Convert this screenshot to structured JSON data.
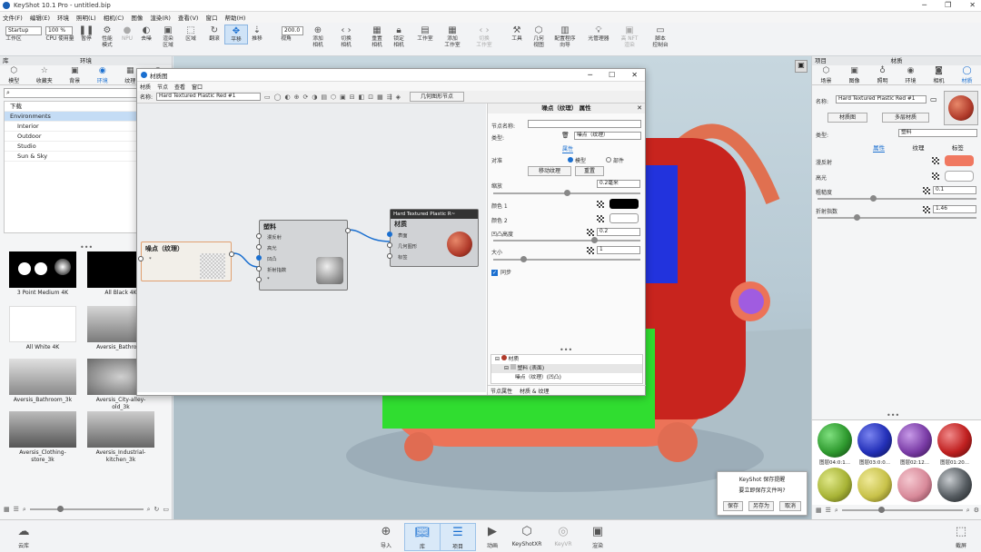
{
  "window": {
    "title": "KeyShot 10.1 Pro  -  untitled.bip"
  },
  "menu": [
    "文件(F)",
    "编辑(E)",
    "环境",
    "照明(L)",
    "相机(C)",
    "图像",
    "渲染(R)",
    "查看(V)",
    "窗口",
    "帮助(H)"
  ],
  "toolbar": {
    "preset": "Startup",
    "zoom": "100 %",
    "speed": "200.0",
    "items": [
      {
        "label": "工作区",
        "icon": "workspace"
      },
      {
        "label": "CPU 使用量",
        "icon": "cpu"
      },
      {
        "label": "暂停",
        "icon": "pause"
      },
      {
        "label": "性能\n模式",
        "icon": "performance"
      },
      {
        "label": "NPU",
        "icon": "npu"
      },
      {
        "label": "去噪",
        "icon": "denoise"
      },
      {
        "label": "渲染\n区域",
        "icon": "region"
      },
      {
        "label": "区域",
        "icon": "region2"
      },
      {
        "label": "翻滚",
        "icon": "tumble"
      },
      {
        "label": "平移",
        "icon": "pan"
      },
      {
        "label": "推移",
        "icon": "dolly"
      },
      {
        "label": "视角",
        "icon": "perspective"
      },
      {
        "label": "添加\n相机",
        "icon": "add-camera"
      },
      {
        "label": "切换\n相机",
        "icon": "switch-camera"
      },
      {
        "label": "重置\n相机",
        "icon": "reset-camera"
      },
      {
        "label": "锁定\n相机",
        "icon": "lock-camera"
      },
      {
        "label": "工作室",
        "icon": "studio"
      },
      {
        "label": "添加\n工作室",
        "icon": "add-studio"
      },
      {
        "label": "切换\n工作室",
        "icon": "switch-studio"
      },
      {
        "label": "工具",
        "icon": "tools"
      },
      {
        "label": "几何\n视图",
        "icon": "geometry"
      },
      {
        "label": "配置程序\n向导",
        "icon": "configurator"
      },
      {
        "label": "光管理器",
        "icon": "light-manager"
      },
      {
        "label": "高 NFT\n渲染",
        "icon": "nft"
      },
      {
        "label": "脚本\n控制台",
        "icon": "script"
      }
    ]
  },
  "library": {
    "title": "库",
    "env_title": "环境",
    "tabs": [
      "模型",
      "收藏夹",
      "背景",
      "环境",
      "纹理",
      "颜色"
    ],
    "tree": [
      "下载",
      "Environments",
      "Interior",
      "Outdoor",
      "Studio",
      "Sun & Sky"
    ],
    "thumbs": [
      "3 Point Medium 4K",
      "All Black 4K",
      "All White 4K",
      "Aversis_Bathroom",
      "Aversis_Bathroom_3k",
      "Aversis_City-alley-old_3k",
      "Aversis_Clothing-store_3k",
      "Aversis_Industrial-kitchen_3k"
    ]
  },
  "bottom": [
    "云库",
    "导入",
    "库",
    "项目",
    "动画",
    "KeyShotXR",
    "KeyVR",
    "渲染"
  ],
  "bottom_right": "截屏",
  "dialog": {
    "title": "材质图",
    "menu": [
      "材质",
      "节点",
      "查看",
      "窗口"
    ],
    "name_label": "名称:",
    "name_value": "Hard Textured Plastic Red #1",
    "geom_label": "几何图形节点",
    "nodes": {
      "bump": {
        "title": "噪点（纹理）",
        "ports": [
          "*"
        ]
      },
      "plastic": {
        "title": "塑料",
        "ports": [
          "漫反射",
          "高光",
          "凹凸",
          "折射指数",
          "*"
        ]
      },
      "material": {
        "header": "Hard Textured Plastic R~",
        "title": "材质",
        "ports": [
          "表面",
          "几何图形",
          "标签"
        ]
      }
    },
    "props": {
      "title": "噪点（纹理） 属性",
      "node_name_label": "节点名称:",
      "type_label": "类型:",
      "type_value": "噪点（纹理）",
      "tab": "属性",
      "align_label": "对准",
      "model": "模型",
      "part": "部件",
      "move_tex": "移动纹理",
      "reset": "重置",
      "scale_label": "缩放",
      "scale_value": "0.2毫米",
      "color1": "颜色 1",
      "color2": "颜色 2",
      "bump_label": "凹凸高度",
      "bump_value": "0.2",
      "size_label": "大小",
      "size_value": "1",
      "sync": "同步",
      "tree": [
        "材质",
        "塑料 (表面)",
        "噪点（纹理）(凹凸)"
      ],
      "bottom_tabs": [
        "节点属性",
        "材质 & 纹理"
      ]
    }
  },
  "project": {
    "title": "项目",
    "mat_title": "材质",
    "tabs": [
      "场景",
      "图像",
      "照明",
      "环境",
      "相机",
      "材质"
    ],
    "name_label": "名称:",
    "name_value": "Hard Textured Plastic Red #1",
    "graph_btn": "材质图",
    "multi_btn": "多层材质",
    "type_label": "类型:",
    "type_value": "塑料",
    "subtabs": [
      "属性",
      "纹理",
      "标签"
    ],
    "diffuse": "漫反射",
    "specular": "高光",
    "roughness": "粗糙度",
    "roughness_value": "0.1",
    "ior": "折射指数",
    "ior_value": "1.46",
    "swatches": [
      {
        "label": "图层04:0:1...",
        "color": "#2f9a2f"
      },
      {
        "label": "图层03:0:0...",
        "color": "#2330b8"
      },
      {
        "label": "图层02:12...",
        "color": "#7a3ca6"
      },
      {
        "label": "图层01:20...",
        "color": "#c02020"
      },
      {
        "label": "",
        "color": "#a8b436"
      },
      {
        "label": "",
        "color": "#c8c24a"
      },
      {
        "label": "",
        "color": "#d88a9a"
      },
      {
        "label": "",
        "color": "#555b60"
      }
    ]
  },
  "savepop": {
    "title": "KeyShot 保存提醒",
    "msg": "要立即保存文件吗?",
    "save": "保存",
    "saveas": "另存为",
    "cancel": "取消"
  },
  "colors": {
    "accent": "#1a6fd0",
    "orange": "#f07860",
    "red_ball": "#b03a2a"
  }
}
